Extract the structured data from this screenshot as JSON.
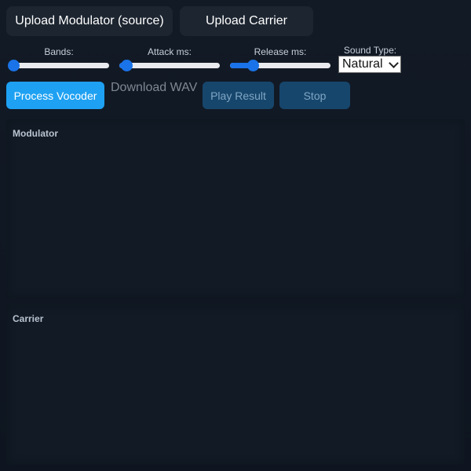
{
  "uploads": {
    "modulator_label": "Upload Modulator (source)",
    "carrier_label": "Upload Carrier"
  },
  "sliders": [
    {
      "label": "Bands:",
      "level_percent": 5
    },
    {
      "label": "Attack ms:",
      "level_percent": 7
    },
    {
      "label": "Release ms:",
      "level_percent": 23
    }
  ],
  "sound_type": {
    "label": "Sound Type:",
    "selected": "Natural"
  },
  "actions": {
    "process_label": "Process Vocoder",
    "download_label": "Download WAV",
    "play_label": "Play Result",
    "stop_label": "Stop"
  },
  "panels": {
    "modulator_title": "Modulator",
    "carrier_title": "Carrier"
  },
  "colors": {
    "accent": "#1ea1f2",
    "slider_accent": "#1a73e8",
    "disabled_button": "#17466c",
    "background": "#0f1622"
  }
}
